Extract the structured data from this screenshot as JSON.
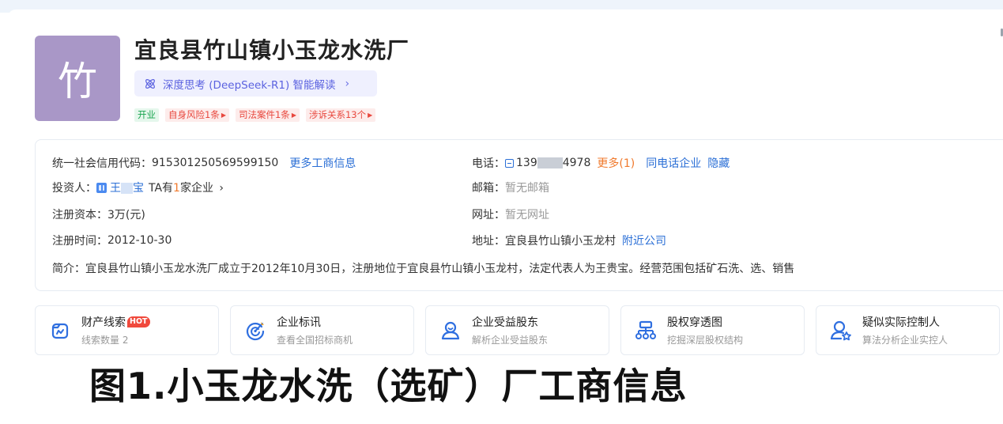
{
  "company": {
    "logo_char": "竹",
    "name": "宜良县竹山镇小玉龙水洗厂"
  },
  "ai": {
    "label": "深度思考 (DeepSeek-R1) 智能解读",
    "chevron": "›"
  },
  "tags": [
    {
      "text": "开业",
      "style": "green"
    },
    {
      "text": "自身风险1条",
      "style": "red"
    },
    {
      "text": "司法案件1条",
      "style": "red"
    },
    {
      "text": "涉诉关系13个",
      "style": "red"
    }
  ],
  "info": {
    "credit_code_label": "统一社会信用代码：",
    "credit_code": "915301250569599150",
    "more_business": "更多工商信息",
    "investor_label": "投资人：",
    "investor_name_a": "王",
    "investor_name_b": "宝",
    "investor_ta_a": "TA有",
    "investor_ta_count": "1",
    "investor_ta_b": "家企业",
    "investor_chevron": "›",
    "capital_label": "注册资本：",
    "capital": "3万(元)",
    "reg_time_label": "注册时间：",
    "reg_time": "2012-10-30",
    "phone_label": "电话：",
    "phone_prefix": "139",
    "phone_suffix": "4978",
    "phone_more": "更多(1)",
    "same_phone": "同电话企业",
    "hide": "隐藏",
    "email_label": "邮箱：",
    "email": "暂无邮箱",
    "website_label": "网址：",
    "website": "暂无网址",
    "address_label": "地址：",
    "address": "宜良县竹山镇小玉龙村",
    "nearby": "附近公司",
    "intro_label": "简介：",
    "intro": "宜良县竹山镇小玉龙水洗厂成立于2012年10月30日，注册地位于宜良县竹山镇小玉龙村，法定代表人为王贵宝。经营范围包括矿石洗、选、销售"
  },
  "features": [
    {
      "title": "财产线索",
      "badge": "HOT",
      "sub": "线索数量 2",
      "icon": "asset-clue-icon"
    },
    {
      "title": "企业标讯",
      "sub": "查看全国招标商机",
      "icon": "bid-target-icon"
    },
    {
      "title": "企业受益股东",
      "sub": "解析企业受益股东",
      "icon": "beneficiary-icon"
    },
    {
      "title": "股权穿透图",
      "sub": "挖掘深层股权结构",
      "icon": "equity-tree-icon"
    },
    {
      "title": "疑似实际控制人",
      "sub": "算法分析企业实控人",
      "icon": "controller-icon"
    }
  ],
  "caption": "图1.小玉龙水洗（选矿）厂工商信息",
  "colors": {
    "logo_bg": "#a997c7",
    "link": "#2b6fd6",
    "orange": "#f07a2d",
    "ai_text": "#5b62e0",
    "tag_green": "#1aa550",
    "tag_red": "#e8483e",
    "icon_blue": "#2f6fe0",
    "hot": "#f0493c"
  }
}
